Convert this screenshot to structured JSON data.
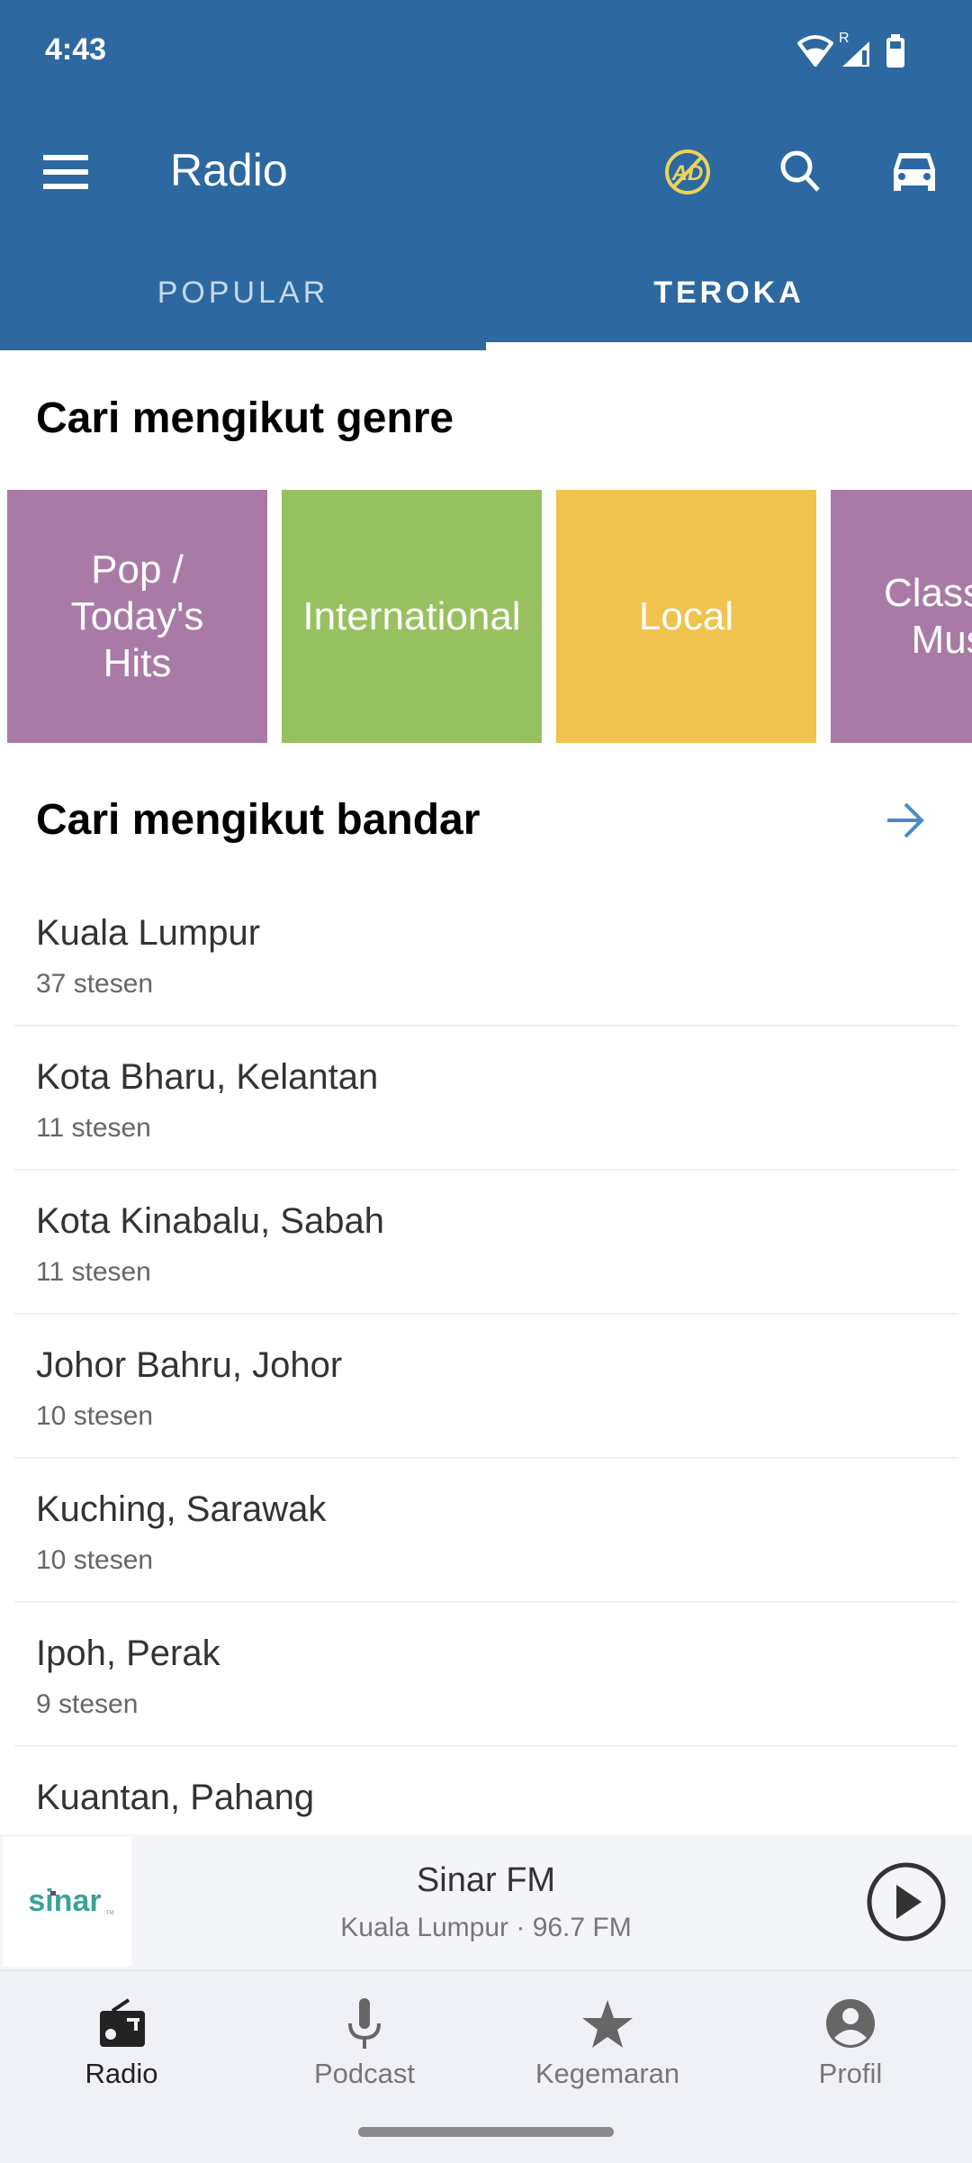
{
  "status_bar": {
    "time": "4:43",
    "icons": [
      "wifi-icon",
      "signal-roaming-icon",
      "battery-icon"
    ],
    "roaming_label": "R"
  },
  "app_bar": {
    "title": "Radio",
    "actions": [
      "no-ads-icon",
      "search-icon",
      "car-mode-icon"
    ],
    "brand_color": "#2d68a1",
    "no_ads_color": "#e9d35a"
  },
  "tabs": [
    {
      "label": "POPULAR",
      "selected": false
    },
    {
      "label": "TEROKA",
      "selected": true
    }
  ],
  "genre_section": {
    "title": "Cari mengikut genre",
    "tiles": [
      {
        "label": "Pop / Today's Hits",
        "color": "#a97aa6"
      },
      {
        "label": "International",
        "color": "#97c15f"
      },
      {
        "label": "Local",
        "color": "#f0c24e"
      },
      {
        "label": "Classical Music",
        "color": "#a97aa6"
      }
    ]
  },
  "city_section": {
    "title": "Cari mengikut bandar",
    "arrow_color": "#4a8bc8",
    "items": [
      {
        "name": "Kuala Lumpur",
        "count": "37 stesen"
      },
      {
        "name": "Kota Bharu, Kelantan",
        "count": "11 stesen"
      },
      {
        "name": "Kota Kinabalu, Sabah",
        "count": "11 stesen"
      },
      {
        "name": "Johor Bahru, Johor",
        "count": "10 stesen"
      },
      {
        "name": "Kuching, Sarawak",
        "count": "10 stesen"
      },
      {
        "name": "Ipoh, Perak",
        "count": "9 stesen"
      },
      {
        "name": "Kuantan, Pahang",
        "count": ""
      }
    ]
  },
  "mini_player": {
    "logo_text": "sinar",
    "station": "Sinar FM",
    "subtitle": "Kuala Lumpur · 96.7 FM",
    "state": "paused"
  },
  "bottom_nav": [
    {
      "label": "Radio",
      "icon": "radio-icon",
      "active": true
    },
    {
      "label": "Podcast",
      "icon": "microphone-icon",
      "active": false
    },
    {
      "label": "Kegemaran",
      "icon": "star-icon",
      "active": false
    },
    {
      "label": "Profil",
      "icon": "profile-icon",
      "active": false
    }
  ]
}
